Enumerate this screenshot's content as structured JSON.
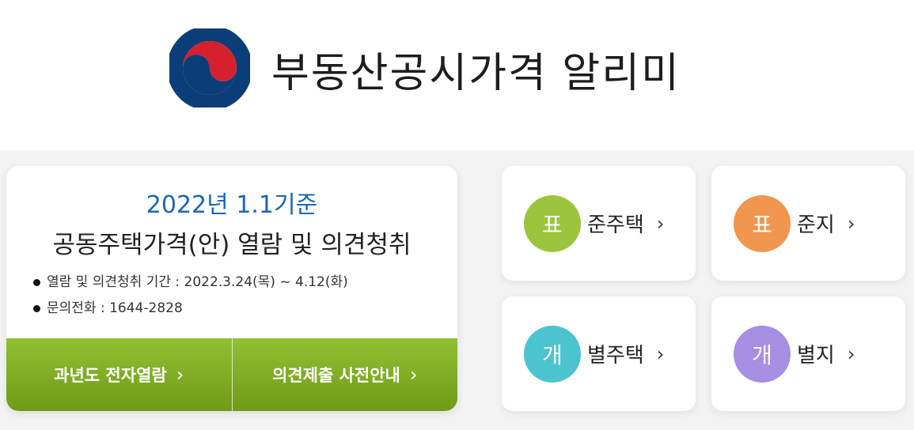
{
  "header": {
    "title": "부동산공시가격 알리미",
    "logo_icon": "taegeuk-logo-icon",
    "logo_colors": {
      "blue": "#0b3d79",
      "red": "#d6202e"
    }
  },
  "notice": {
    "date": "2022년 1.1기준",
    "title": "공동주택가격(안) 열람 및 의견청취",
    "items": [
      {
        "label": "열람 및 의견청취 기간 : ",
        "value": "2022.3.24(목) ~ 4.12(화)"
      },
      {
        "label": "문의전화 : ",
        "value": "1644-2828"
      }
    ],
    "buttons": [
      {
        "label": "과년도 전자열람",
        "arrow": "›"
      },
      {
        "label": "의견제출 사전안내",
        "arrow": "›"
      }
    ],
    "accent_color": "#1b68b4",
    "button_color": "#82b12a"
  },
  "categories": [
    {
      "badge": "표",
      "label": "준주택",
      "arrow": "›",
      "color": "#9bc53d"
    },
    {
      "badge": "표",
      "label": "준지",
      "arrow": "›",
      "color": "#f0964f"
    },
    {
      "badge": "개",
      "label": "별주택",
      "arrow": "›",
      "color": "#4cc4cf"
    },
    {
      "badge": "개",
      "label": "별지",
      "arrow": "›",
      "color": "#a68ee3"
    }
  ]
}
